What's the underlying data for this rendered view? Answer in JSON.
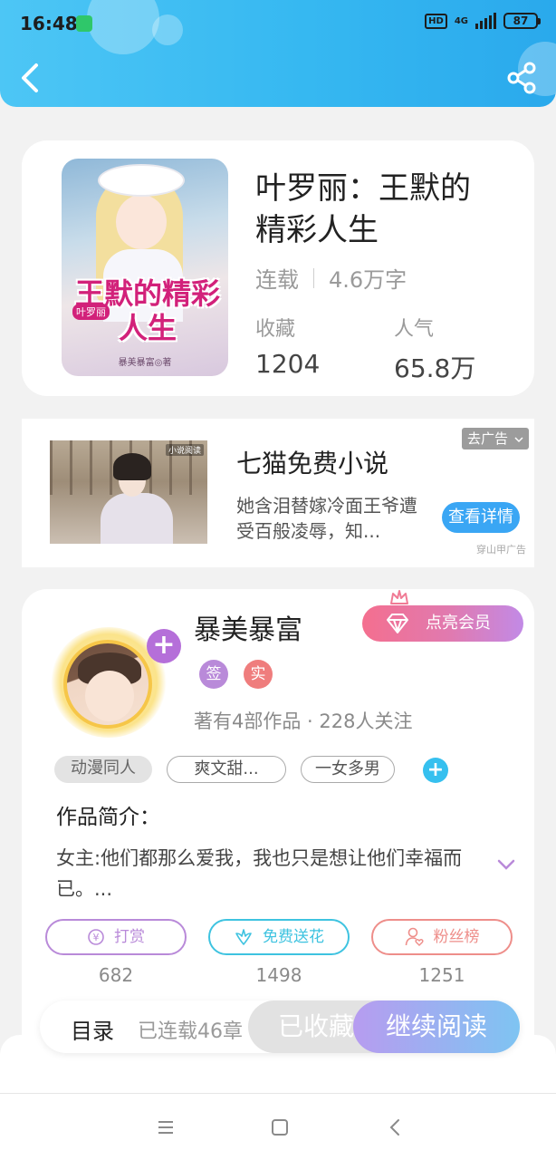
{
  "status_bar": {
    "time": "16:48",
    "network": "4G",
    "hd": "HD",
    "battery": "87"
  },
  "book": {
    "title": "叶罗丽：王默的精彩人生",
    "status": "连载",
    "word_count": "4.6万字",
    "collect_label": "收藏",
    "collect_value": "1204",
    "popularity_label": "人气",
    "popularity_value": "65.8万",
    "cover": {
      "title": "王默的精彩人生",
      "subtitle": "叶罗丽",
      "author": "暴美暴富◎著"
    }
  },
  "ad": {
    "title": "七猫免费小说",
    "description": "她含泪替嫁冷面王爷遭受百般凌辱，知...",
    "close_label": "去广告",
    "cta_label": "查看详情",
    "source": "穿山甲广告",
    "image_badge": "小说阅读"
  },
  "author": {
    "name": "暴美暴富",
    "badges": [
      "签",
      "实"
    ],
    "info": "著有4部作品 · 228人关注",
    "vip_label": "点亮会员"
  },
  "tags": [
    "动漫同人",
    "爽文甜...",
    "一女多男"
  ],
  "intro": {
    "heading": "作品简介：",
    "text": "女主:他们都那么爱我，我也只是想让他们幸福而已。..."
  },
  "actions": [
    {
      "label": "打赏",
      "count": "682",
      "color": "#b98ad9"
    },
    {
      "label": "免费送花",
      "count": "1498",
      "color": "#3ec3e0"
    },
    {
      "label": "粉丝榜",
      "count": "1251",
      "color": "#ee8e8a"
    }
  ],
  "bottom_bar": {
    "toc_label": "目录",
    "toc_status": "已连载46章",
    "favorite_label": "已收藏",
    "read_label": "继续阅读"
  }
}
